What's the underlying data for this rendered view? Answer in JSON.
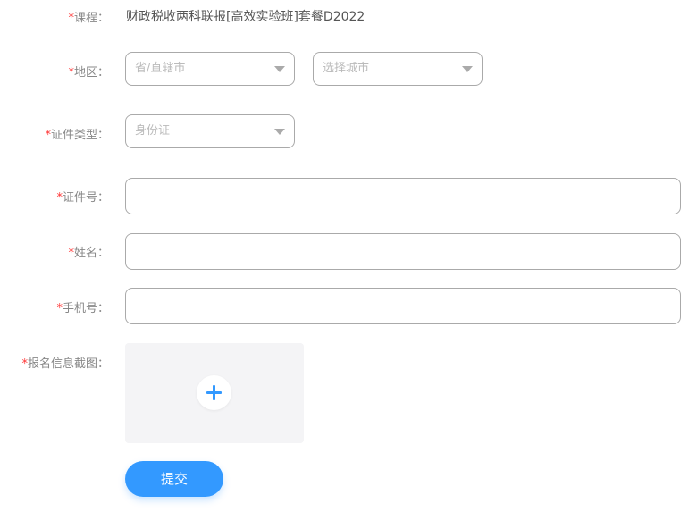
{
  "form": {
    "required_mark": "*",
    "course": {
      "label": "课程：",
      "value": "财政税收两科联报[高效实验班]套餐D2022"
    },
    "region": {
      "label": "地区：",
      "province_placeholder": "省/直辖市",
      "city_placeholder": "选择城市"
    },
    "id_type": {
      "label": "证件类型：",
      "value": "身份证"
    },
    "id_number": {
      "label": "证件号：",
      "value": ""
    },
    "name": {
      "label": "姓名：",
      "value": ""
    },
    "phone": {
      "label": "手机号：",
      "value": ""
    },
    "screenshot": {
      "label": "报名信息截图："
    },
    "submit_label": "提交"
  }
}
